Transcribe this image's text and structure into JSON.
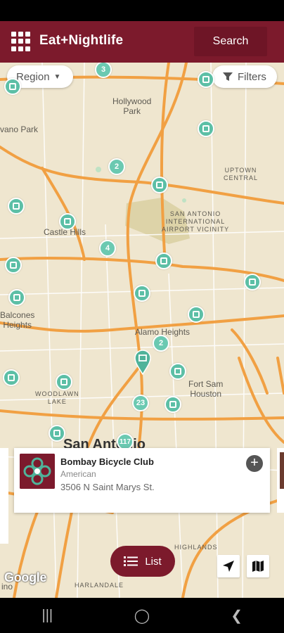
{
  "header": {
    "app_title": "Eat+Nightlife",
    "search_label": "Search"
  },
  "map": {
    "region_label": "Region",
    "filters_label": "Filters",
    "labels": {
      "hollywood_park": "Hollywood\nPark",
      "uptown_central": "UPTOWN\nCENTRAL",
      "airport": "SAN ANTONIO\nINTERNATIONAL\nAIRPORT VICINITY",
      "castle_hills": "Castle Hills",
      "balcones": "Balcones\nHeights",
      "alamo_heights": "Alamo Heights",
      "fort_sam": "Fort Sam\nHouston",
      "woodlawn": "WOODLAWN\nLAKE",
      "san_antonio": "San Antonio",
      "highlands": "HIGHLANDS",
      "harlandale": "HARLANDALE",
      "park_partial": "vano Park",
      "ino": "ino"
    },
    "cluster_counts": [
      "3",
      "2",
      "4",
      "2",
      "23",
      "117"
    ],
    "attribution": "Google"
  },
  "card": {
    "name": "Bombay Bicycle Club",
    "category": "American",
    "address": "3506 N Saint Marys St."
  },
  "list_button": "List",
  "colors": {
    "brand": "#7c1a2c",
    "marker": "#5cbfa6",
    "road": "#f1a043",
    "map_bg": "#efe6cf"
  }
}
